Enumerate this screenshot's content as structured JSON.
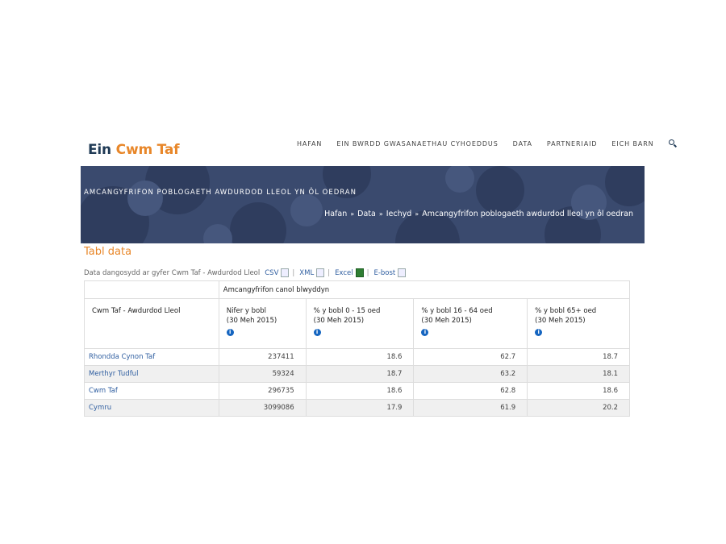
{
  "logo": {
    "part1": "Ein",
    "part2": "Cwm Taf"
  },
  "nav": {
    "items": [
      "HAFAN",
      "EIN BWRDD GWASANAETHAU CYHOEDDUS",
      "DATA",
      "PARTNERIAID",
      "EICH BARN"
    ],
    "search_icon": "search-icon"
  },
  "banner": {
    "title": "AMCANGYFRIFON POBLOGAETH AWDURDOD LLEOL YN ÔL OEDRAN",
    "breadcrumbs": [
      "Hafan",
      "Data",
      "Iechyd",
      "Amcangyfrifon poblogaeth awdurdod lleol yn ôl oedran"
    ],
    "sep": "»"
  },
  "section_title": "Tabl data",
  "downloads": {
    "intro": "Data dangosydd ar gyfer Cwm Taf - Awdurdod Lleol",
    "csv": "CSV",
    "xml": "XML",
    "excel": "Excel",
    "email": "E-bost",
    "pipe": "|"
  },
  "table": {
    "group_header": "Amcangyfrifon canol blwyddyn",
    "col0": "Cwm Taf - Awdurdod Lleol",
    "col1": [
      "Nifer y bobl",
      "(30 Meh 2015)"
    ],
    "col2": [
      "% y bobl 0 - 15 oed",
      "(30 Meh 2015)"
    ],
    "col3": [
      "% y bobl 16 - 64 oed",
      "(30 Meh 2015)"
    ],
    "col4": [
      "% y bobl 65+ oed",
      "(30 Meh 2015)"
    ],
    "info_glyph": "i",
    "rows": [
      {
        "name": "Rhondda Cynon Taf",
        "count": "237411",
        "p0_15": "18.6",
        "p16_64": "62.7",
        "p65": "18.7"
      },
      {
        "name": "Merthyr Tudful",
        "count": "59324",
        "p0_15": "18.7",
        "p16_64": "63.2",
        "p65": "18.1"
      },
      {
        "name": "Cwm Taf",
        "count": "296735",
        "p0_15": "18.6",
        "p16_64": "62.8",
        "p65": "18.6"
      },
      {
        "name": "Cymru",
        "count": "3099086",
        "p0_15": "17.9",
        "p16_64": "61.9",
        "p65": "20.2"
      }
    ]
  }
}
